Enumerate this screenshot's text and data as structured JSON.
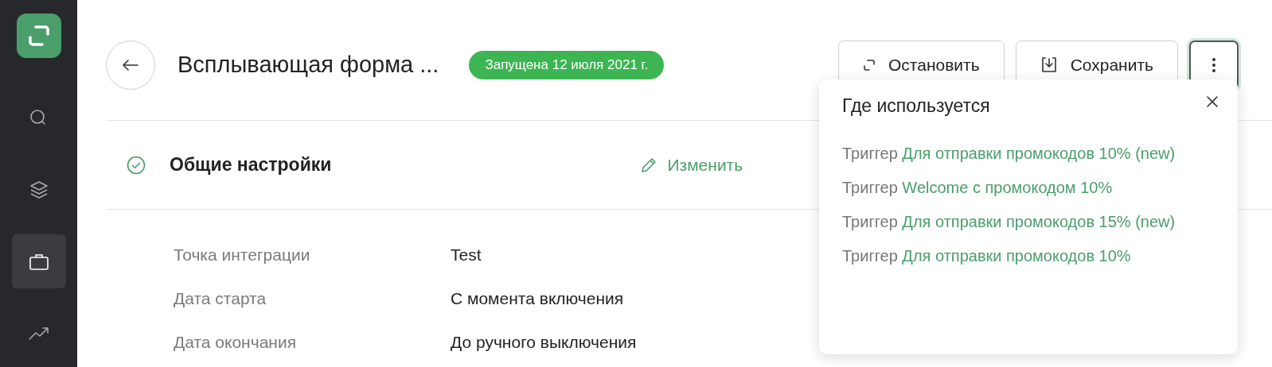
{
  "sidebar": {
    "items": [
      {
        "kind": "search",
        "selected": false
      },
      {
        "kind": "layers",
        "selected": false
      },
      {
        "kind": "briefcase",
        "selected": true
      },
      {
        "kind": "chart",
        "selected": false
      }
    ]
  },
  "header": {
    "title": "Всплывающая форма ...",
    "status": "Запущена 12 июля 2021 г.",
    "buttons": [
      {
        "kind": "stop",
        "label": "Остановить"
      },
      {
        "kind": "save",
        "label": "Сохранить"
      }
    ],
    "more": {
      "expanded": true
    }
  },
  "section": {
    "title": "Общие настройки",
    "done": true,
    "edit": "Изменить"
  },
  "fields": [
    {
      "label": "Точка интеграции",
      "value": "Test"
    },
    {
      "label": "Дата старта",
      "value": "С момента включения"
    },
    {
      "label": "Дата окончания",
      "value": "До ручного выключения"
    }
  ],
  "popup": {
    "title": "Где используется",
    "items": [
      {
        "prefix": "Триггер",
        "name": "Для отправки промокодов 10% (new)"
      },
      {
        "prefix": "Триггер",
        "name": "Welcome с промокодом 10%"
      },
      {
        "prefix": "Триггер",
        "name": "Для отправки промокодов 15% (new)"
      },
      {
        "prefix": "Триггер",
        "name": "Для отправки промокодов 10%"
      }
    ]
  }
}
